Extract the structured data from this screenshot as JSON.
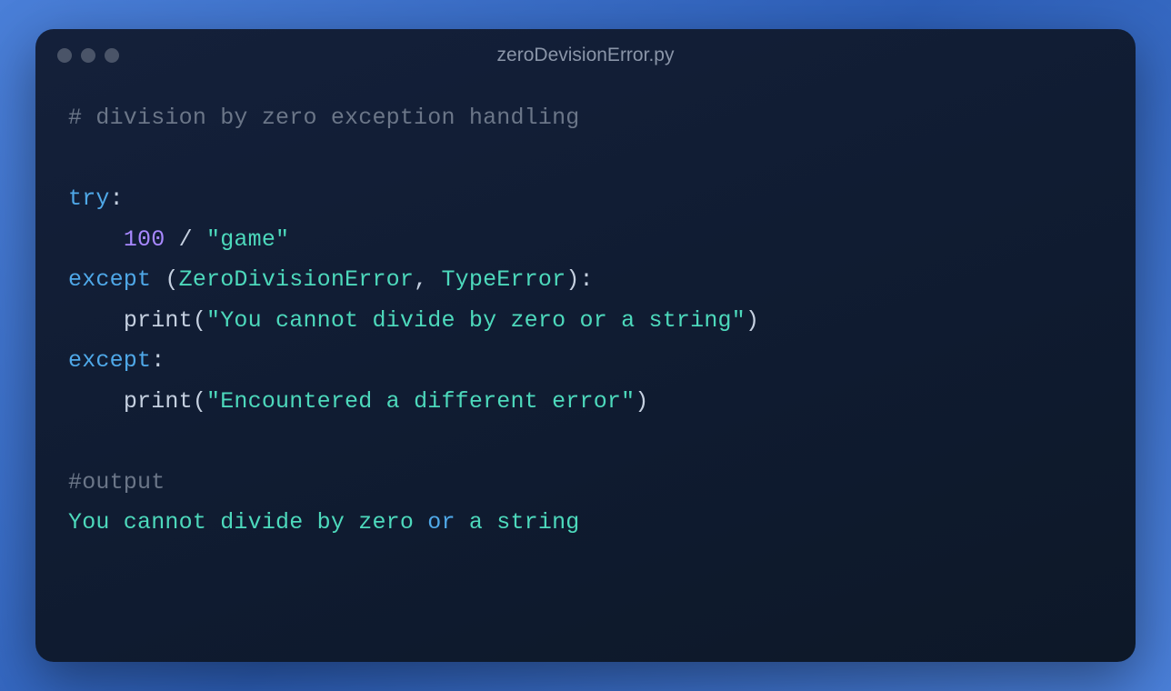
{
  "window": {
    "title": "zeroDevisionError.py"
  },
  "code": {
    "comment1": "# division by zero exception handling",
    "blank": "",
    "kw_try": "try",
    "colon": ":",
    "indent": "    ",
    "num_100": "100",
    "op_div": " / ",
    "str_game": "\"game\"",
    "kw_except": "except",
    "sp": " ",
    "lparen": "(",
    "cls_zde": "ZeroDivisionError",
    "comma": ", ",
    "cls_te": "TypeError",
    "rparen": ")",
    "fn_print": "print",
    "str_msg1": "\"You cannot divide by zero or a string\"",
    "str_msg2": "\"Encountered a different error\"",
    "comment2": "#output",
    "out_a": "You cannot divide by zero ",
    "out_kw_or": "or",
    "out_b": " a string"
  }
}
